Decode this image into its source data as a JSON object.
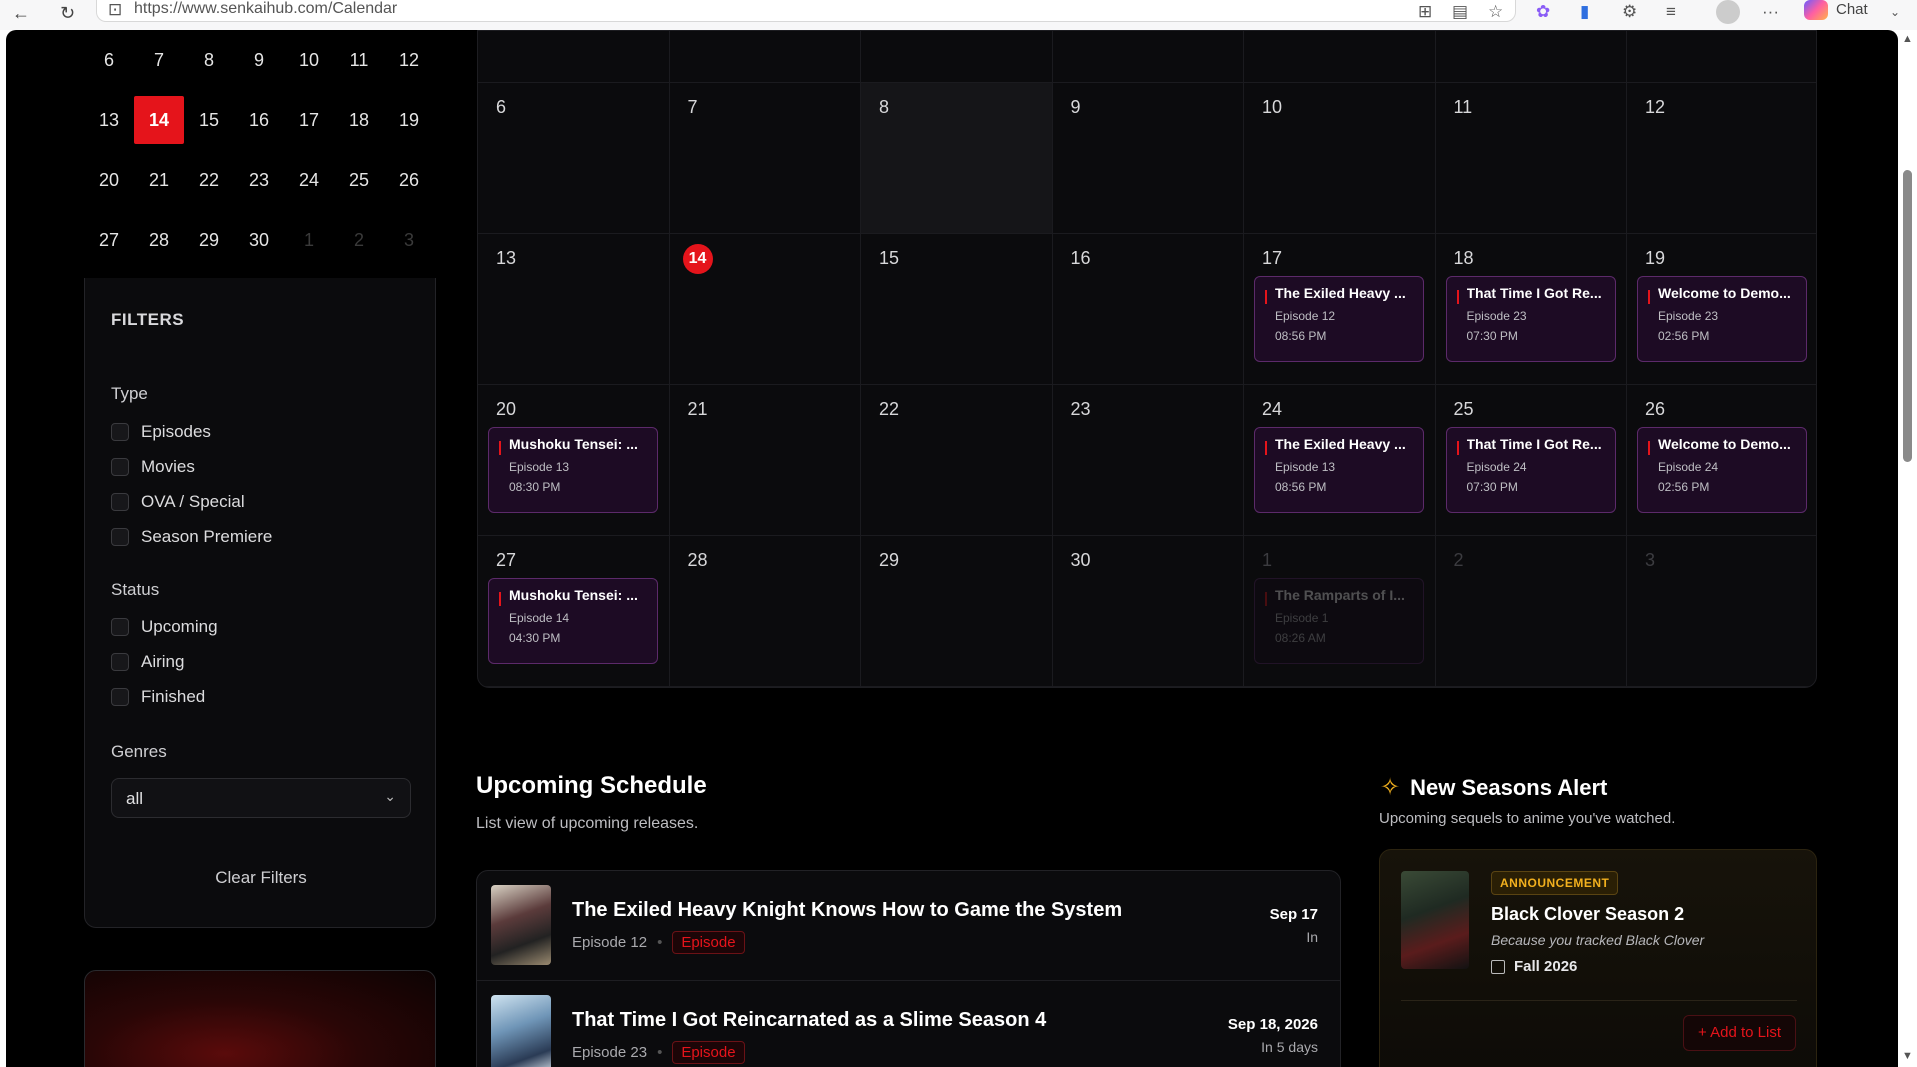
{
  "browser": {
    "url": "https://www.senkaihub.com/Calendar",
    "chat_label": "Chat"
  },
  "mini_calendar": {
    "rows": [
      [
        {
          "d": "6"
        },
        {
          "d": "7"
        },
        {
          "d": "8"
        },
        {
          "d": "9"
        },
        {
          "d": "10"
        },
        {
          "d": "11"
        },
        {
          "d": "12"
        }
      ],
      [
        {
          "d": "13"
        },
        {
          "d": "14",
          "selected": true
        },
        {
          "d": "15"
        },
        {
          "d": "16"
        },
        {
          "d": "17"
        },
        {
          "d": "18"
        },
        {
          "d": "19"
        }
      ],
      [
        {
          "d": "20"
        },
        {
          "d": "21"
        },
        {
          "d": "22"
        },
        {
          "d": "23"
        },
        {
          "d": "24"
        },
        {
          "d": "25"
        },
        {
          "d": "26"
        }
      ],
      [
        {
          "d": "27"
        },
        {
          "d": "28"
        },
        {
          "d": "29"
        },
        {
          "d": "30"
        },
        {
          "d": "1",
          "dim": true
        },
        {
          "d": "2",
          "dim": true
        },
        {
          "d": "3",
          "dim": true
        }
      ]
    ]
  },
  "filters": {
    "title": "FILTERS",
    "type_label": "Type",
    "types": [
      "Episodes",
      "Movies",
      "OVA / Special",
      "Season Premiere"
    ],
    "status_label": "Status",
    "statuses": [
      "Upcoming",
      "Airing",
      "Finished"
    ],
    "genres_label": "Genres",
    "genres_value": "all",
    "clear_label": "Clear Filters"
  },
  "calendar": {
    "today": "14",
    "weeks": [
      [
        {
          "d": "6"
        },
        {
          "d": "7"
        },
        {
          "d": "8",
          "highlight": true
        },
        {
          "d": "9"
        },
        {
          "d": "10"
        },
        {
          "d": "11"
        },
        {
          "d": "12"
        }
      ],
      [
        {
          "d": "13"
        },
        {
          "d": "14",
          "today": true
        },
        {
          "d": "15"
        },
        {
          "d": "16"
        },
        {
          "d": "17"
        },
        {
          "d": "18"
        },
        {
          "d": "19"
        }
      ],
      [
        {
          "d": "20"
        },
        {
          "d": "21"
        },
        {
          "d": "22"
        },
        {
          "d": "23"
        },
        {
          "d": "24"
        },
        {
          "d": "25"
        },
        {
          "d": "26"
        }
      ],
      [
        {
          "d": "27"
        },
        {
          "d": "28"
        },
        {
          "d": "29"
        },
        {
          "d": "30"
        },
        {
          "d": "1",
          "dim": true
        },
        {
          "d": "2",
          "dim": true
        },
        {
          "d": "3",
          "dim": true
        }
      ]
    ],
    "events": [
      {
        "week": 1,
        "day": 4,
        "title": "The Exiled Heavy ...",
        "episode": "Episode 12",
        "time": "08:56 PM"
      },
      {
        "week": 1,
        "day": 5,
        "title": "That Time I Got Re...",
        "episode": "Episode 23",
        "time": "07:30 PM"
      },
      {
        "week": 1,
        "day": 6,
        "title": "Welcome to Demo...",
        "episode": "Episode 23",
        "time": "02:56 PM"
      },
      {
        "week": 2,
        "day": 0,
        "title": "Mushoku Tensei: ...",
        "episode": "Episode 13",
        "time": "08:30 PM"
      },
      {
        "week": 2,
        "day": 4,
        "title": "The Exiled Heavy ...",
        "episode": "Episode 13",
        "time": "08:56 PM"
      },
      {
        "week": 2,
        "day": 5,
        "title": "That Time I Got Re...",
        "episode": "Episode 24",
        "time": "07:30 PM"
      },
      {
        "week": 2,
        "day": 6,
        "title": "Welcome to Demo...",
        "episode": "Episode 24",
        "time": "02:56 PM"
      },
      {
        "week": 3,
        "day": 0,
        "title": "Mushoku Tensei: ...",
        "episode": "Episode 14",
        "time": "04:30 PM"
      },
      {
        "week": 3,
        "day": 4,
        "title": "The Ramparts of I...",
        "episode": "Episode 1",
        "time": "08:26 AM",
        "faded": true
      }
    ]
  },
  "upcoming": {
    "title": "Upcoming Schedule",
    "subtitle": "List view of upcoming releases.",
    "items": [
      {
        "name": "The Exiled Heavy Knight Knows How to Game the System",
        "episode": "Episode 12",
        "tag": "Episode",
        "date": "Sep 17",
        "relative": "In"
      },
      {
        "name": "That Time I Got Reincarnated as a Slime Season 4",
        "episode": "Episode 23",
        "tag": "Episode",
        "date": "Sep 18, 2026",
        "relative": "In 5 days"
      }
    ]
  },
  "new_seasons": {
    "title": "New Seasons Alert",
    "subtitle": "Upcoming sequels to anime you've watched.",
    "card": {
      "badge": "ANNOUNCEMENT",
      "name": "Black Clover Season 2",
      "reason": "Because you tracked Black Clover",
      "season": "Fall 2026",
      "add_label": "Add to List"
    }
  },
  "colors": {
    "accent": "#e5141b",
    "event_bg": "#1d0b24",
    "gold": "#f2b01e"
  }
}
